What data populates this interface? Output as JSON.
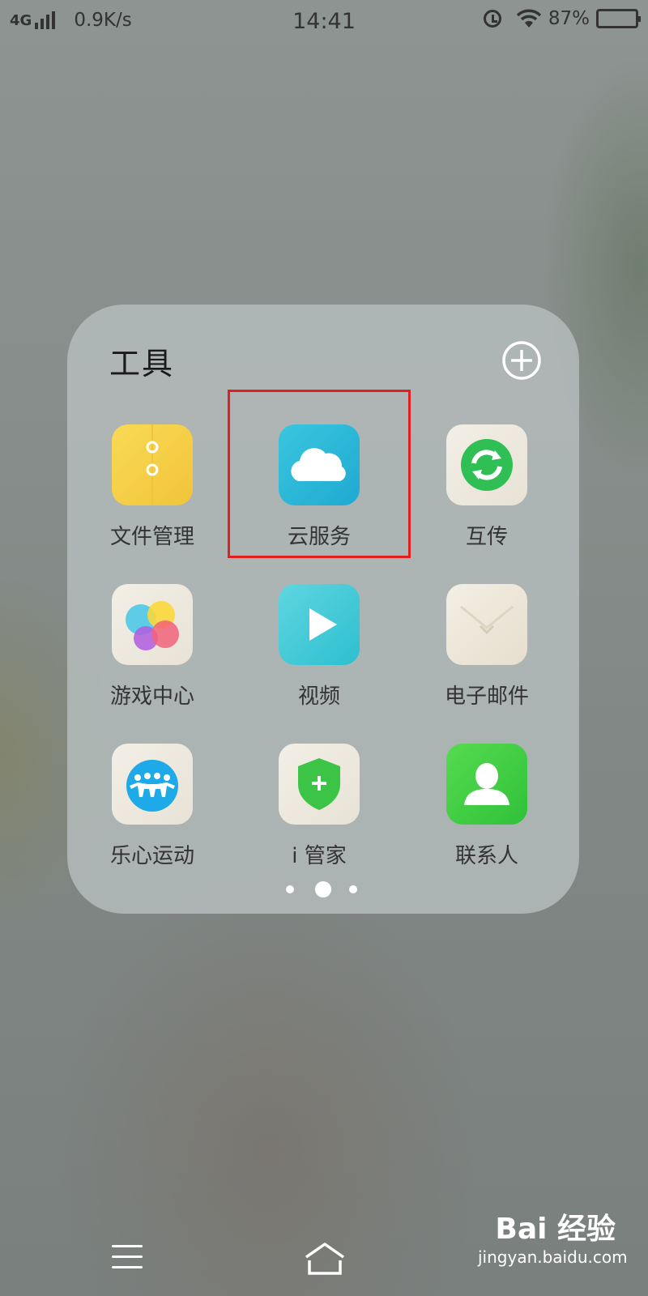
{
  "status_bar": {
    "network": "4G",
    "speed": "0.9K/s",
    "time": "14:41",
    "battery": "87%",
    "battery_level": 0.87
  },
  "folder": {
    "title": "工具",
    "apps": [
      {
        "label": "文件管理",
        "icon": "file-manager-icon"
      },
      {
        "label": "云服务",
        "icon": "cloud-service-icon"
      },
      {
        "label": "互传",
        "icon": "transfer-icon"
      },
      {
        "label": "游戏中心",
        "icon": "game-center-icon"
      },
      {
        "label": "视频",
        "icon": "video-icon"
      },
      {
        "label": "电子邮件",
        "icon": "email-icon"
      },
      {
        "label": "乐心运动",
        "icon": "lifesense-icon"
      },
      {
        "label": "i 管家",
        "icon": "shield-icon"
      },
      {
        "label": "联系人",
        "icon": "contacts-icon"
      }
    ],
    "page_count": 3,
    "current_page": 2
  },
  "watermark": {
    "brand": "Bai 经验",
    "url": "jingyan.baidu.com"
  },
  "colors": {
    "highlight": "#e02020",
    "cloud_blue": "#25b5d8",
    "file_yellow": "#f6cf3f",
    "contact_green": "#3ccc3a"
  }
}
